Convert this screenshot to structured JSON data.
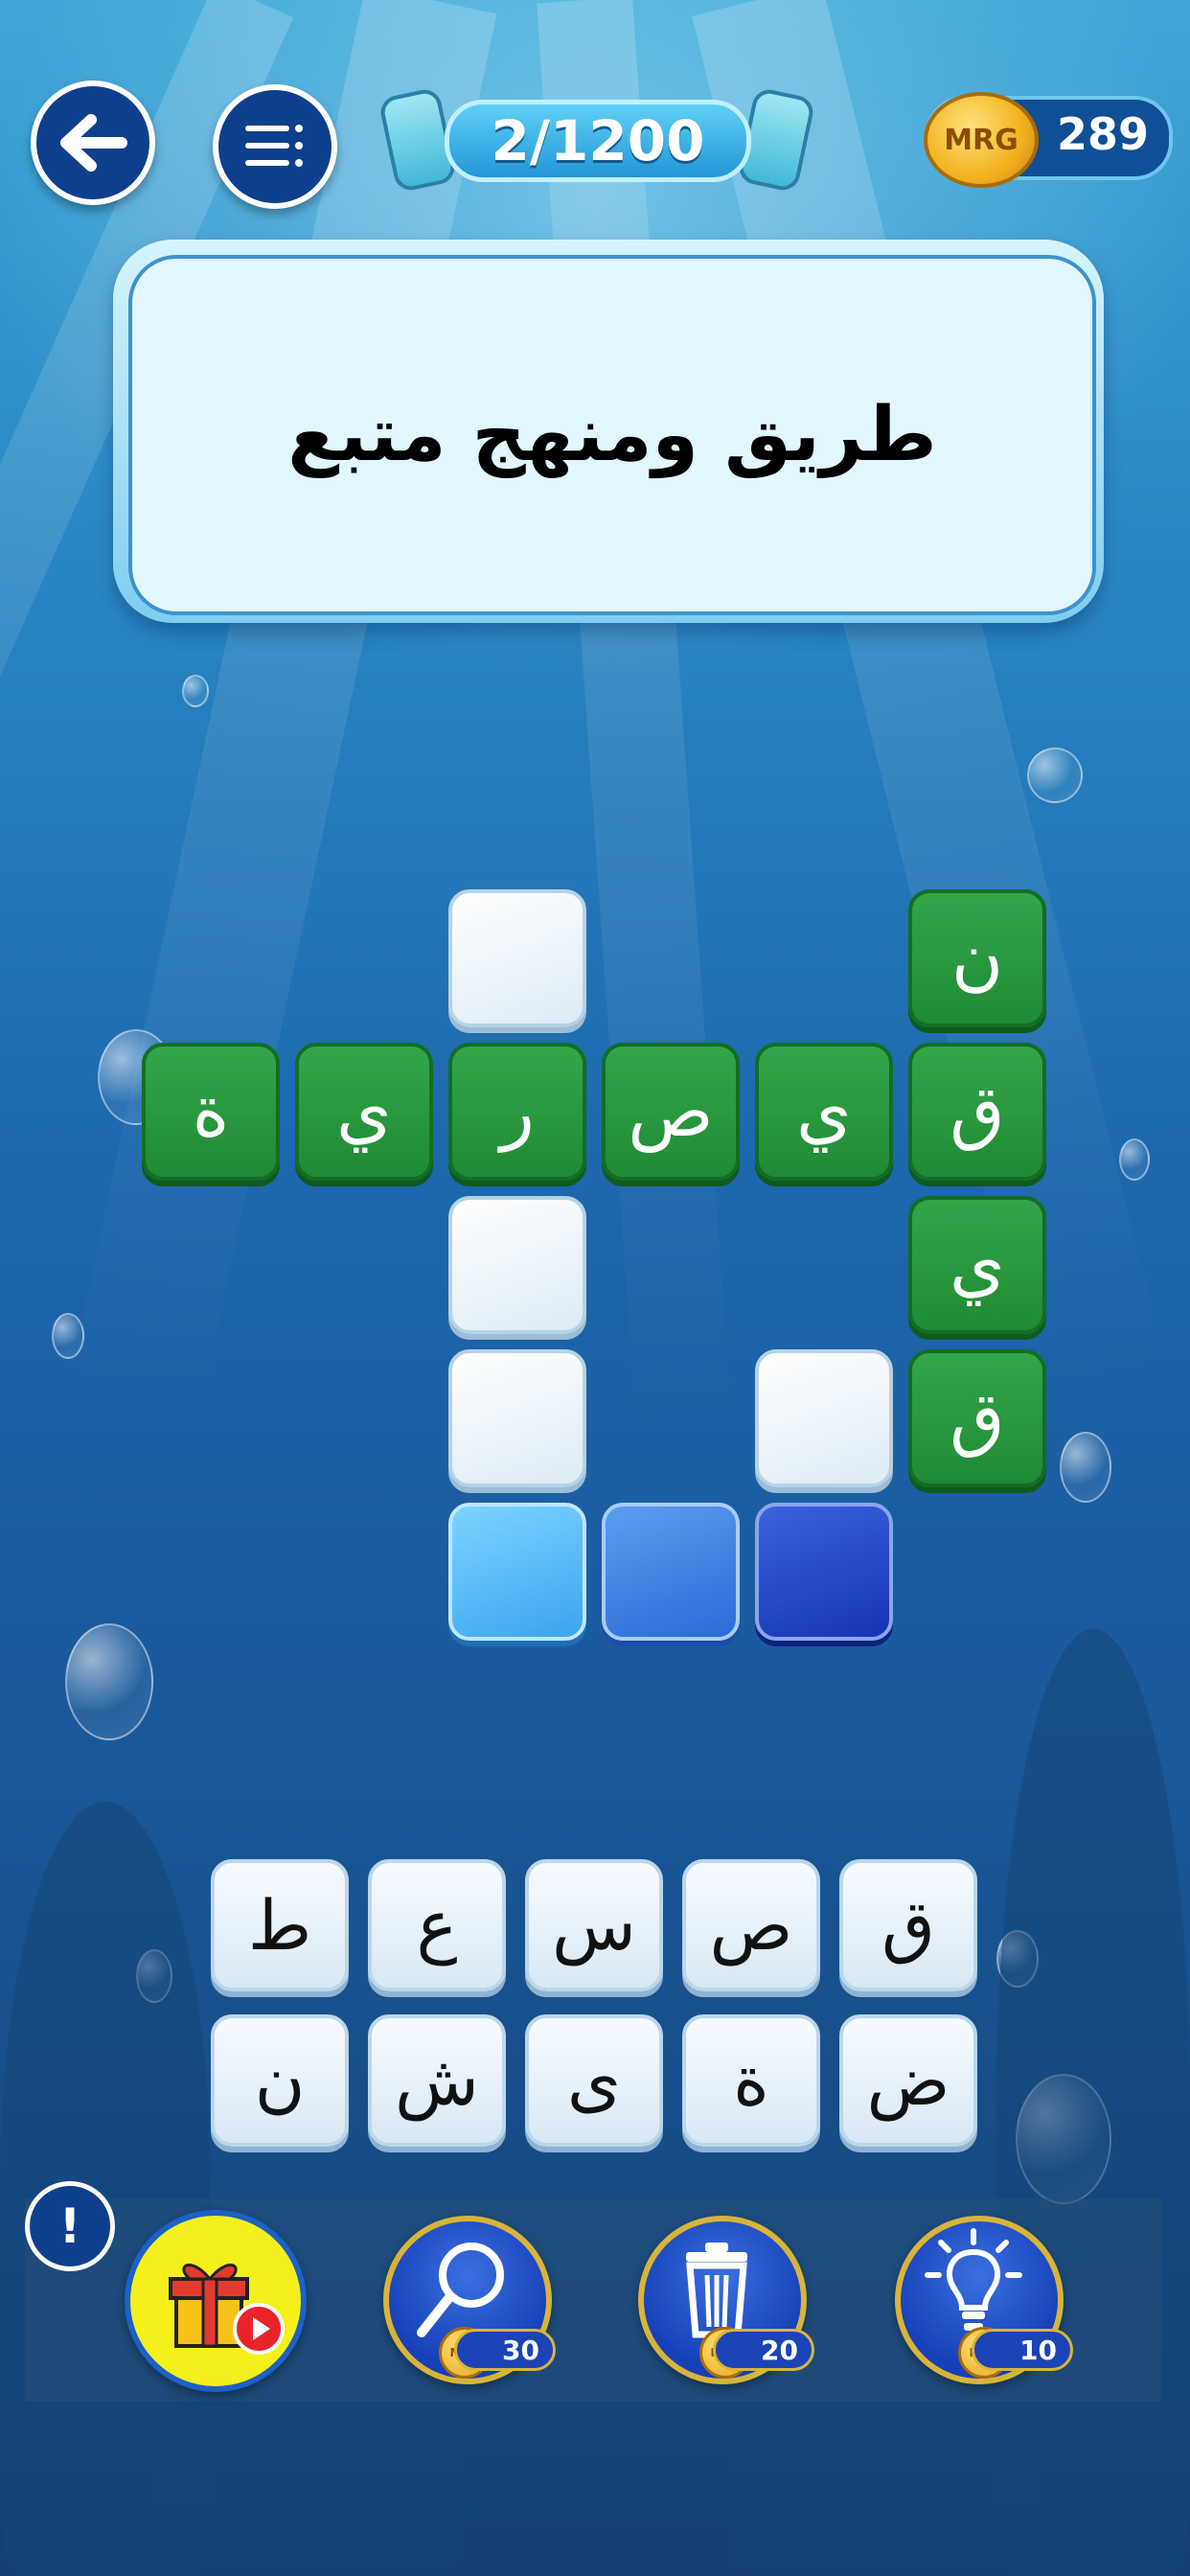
{
  "header": {
    "level": "2/1200",
    "coins": "289",
    "coin_logo": "MRG",
    "back_icon": "arrow-left-icon",
    "menu_icon": "menu-icon"
  },
  "clue": "طريق ومنهج متبع",
  "grid": {
    "green_cells": [
      "ن",
      "ة",
      "ي",
      "ر",
      "ص",
      "ي",
      "ق",
      "ي",
      "ق"
    ]
  },
  "keyboard": {
    "row1": [
      "ط",
      "ع",
      "س",
      "ص",
      "ق"
    ],
    "row2": [
      "ن",
      "ش",
      "ى",
      "ة",
      "ض"
    ]
  },
  "tools": {
    "info_label": "!",
    "search_cost": "30",
    "delete_cost": "20",
    "hint_cost": "10",
    "coin_logo": "MRG"
  },
  "colors": {
    "correct_green": "#1f8a33",
    "header_navy": "#0d3f8c",
    "gift_yellow": "#f5ef1c",
    "coin_gold": "#f2b21e"
  }
}
